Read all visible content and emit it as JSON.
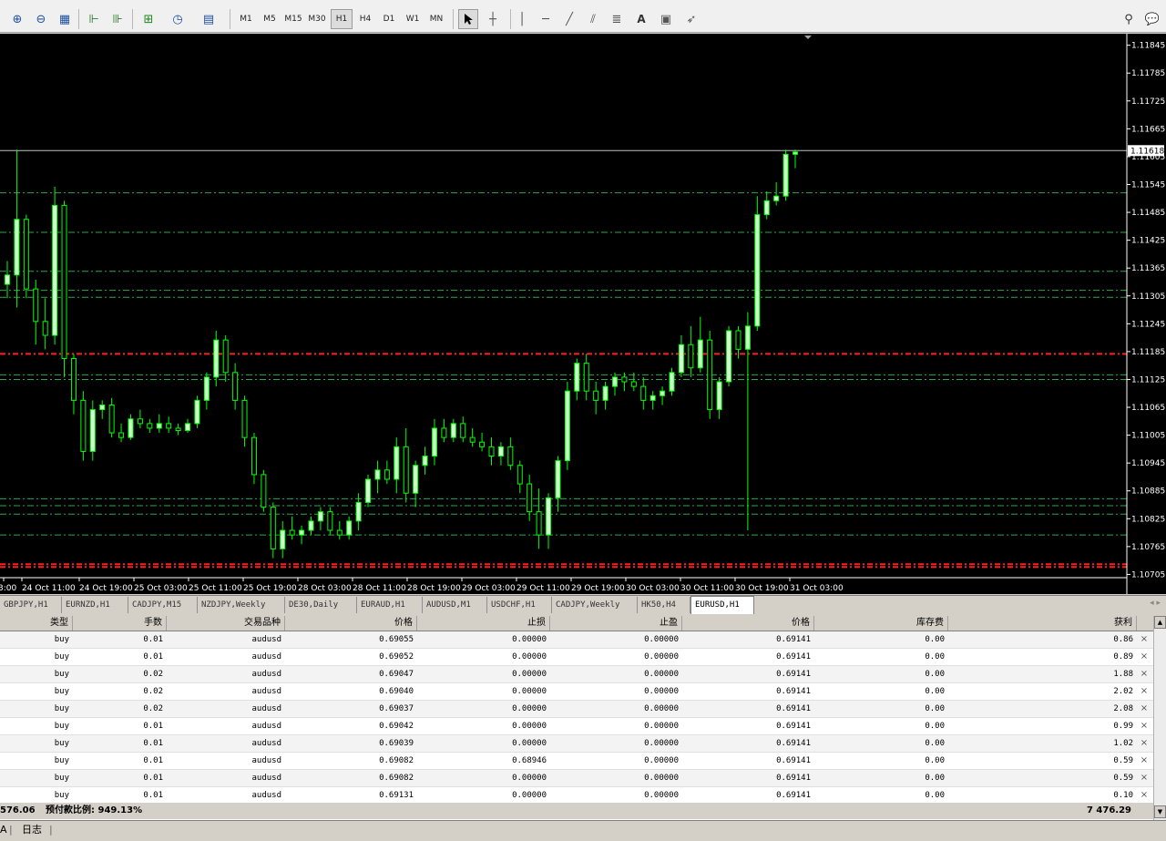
{
  "toolbar": {
    "timeframes": [
      "M1",
      "M5",
      "M15",
      "M30",
      "H1",
      "H4",
      "D1",
      "W1",
      "MN"
    ],
    "active_timeframe": "H1",
    "text_tool": "A"
  },
  "chart": {
    "symbol": "EURUSD",
    "timeframe": "H1",
    "current_price": "1.11618",
    "price_axis_labels": [
      "1.11845",
      "1.11785",
      "1.11725",
      "1.11665",
      "1.11605",
      "1.11545",
      "1.11485",
      "1.11425",
      "1.11365",
      "1.11305",
      "1.11245",
      "1.11185",
      "1.11125",
      "1.11065",
      "1.11005",
      "1.10945",
      "1.10885",
      "1.10825",
      "1.10765",
      "1.10705"
    ],
    "time_axis_labels": [
      "3:00",
      "24 Oct 11:00",
      "24 Oct 19:00",
      "25 Oct 03:00",
      "25 Oct 11:00",
      "25 Oct 19:00",
      "28 Oct 03:00",
      "28 Oct 11:00",
      "28 Oct 19:00",
      "29 Oct 03:00",
      "29 Oct 11:00",
      "29 Oct 19:00",
      "30 Oct 03:00",
      "30 Oct 11:00",
      "30 Oct 19:00",
      "31 Oct 03:00"
    ],
    "colors": {
      "background": "#000000",
      "bull_candle": "#ccffcc",
      "bear_candle": "#000000",
      "wick": "#00ff00",
      "green_level": "#2ea84a",
      "red_level": "#ff2020",
      "price_line": "#c0c0c0"
    }
  },
  "tabs": [
    "GBPJPY,H1",
    "EURNZD,H1",
    "CADJPY,M15",
    "NZDJPY,Weekly",
    "DE30,Daily",
    "EURAUD,H1",
    "AUDUSD,M1",
    "USDCHF,H1",
    "CADJPY,Weekly",
    "HK50,H4",
    "EURUSD,H1"
  ],
  "active_tab": "EURUSD,H1",
  "terminal": {
    "columns": [
      "类型",
      "手数",
      "交易品种",
      "价格",
      "止损",
      "止盈",
      "价格",
      "库存费",
      "获利"
    ],
    "rows": [
      [
        "buy",
        "0.01",
        "audusd",
        "0.69055",
        "0.00000",
        "0.00000",
        "0.69141",
        "0.00",
        "0.86"
      ],
      [
        "buy",
        "0.01",
        "audusd",
        "0.69052",
        "0.00000",
        "0.00000",
        "0.69141",
        "0.00",
        "0.89"
      ],
      [
        "buy",
        "0.02",
        "audusd",
        "0.69047",
        "0.00000",
        "0.00000",
        "0.69141",
        "0.00",
        "1.88"
      ],
      [
        "buy",
        "0.02",
        "audusd",
        "0.69040",
        "0.00000",
        "0.00000",
        "0.69141",
        "0.00",
        "2.02"
      ],
      [
        "buy",
        "0.02",
        "audusd",
        "0.69037",
        "0.00000",
        "0.00000",
        "0.69141",
        "0.00",
        "2.08"
      ],
      [
        "buy",
        "0.01",
        "audusd",
        "0.69042",
        "0.00000",
        "0.00000",
        "0.69141",
        "0.00",
        "0.99"
      ],
      [
        "buy",
        "0.01",
        "audusd",
        "0.69039",
        "0.00000",
        "0.00000",
        "0.69141",
        "0.00",
        "1.02"
      ],
      [
        "buy",
        "0.01",
        "audusd",
        "0.69082",
        "0.68946",
        "0.00000",
        "0.69141",
        "0.00",
        "0.59"
      ],
      [
        "buy",
        "0.01",
        "audusd",
        "0.69082",
        "0.00000",
        "0.00000",
        "0.69141",
        "0.00",
        "0.59"
      ],
      [
        "buy",
        "0.01",
        "audusd",
        "0.69131",
        "0.00000",
        "0.00000",
        "0.69141",
        "0.00",
        "0.10"
      ]
    ],
    "summary": {
      "left_value": "576.06",
      "margin_level": "预付款比例: 949.13%",
      "total_profit": "7 476.29"
    }
  },
  "statusbar": {
    "left_fragment": "A",
    "journal_tab": "日志"
  }
}
